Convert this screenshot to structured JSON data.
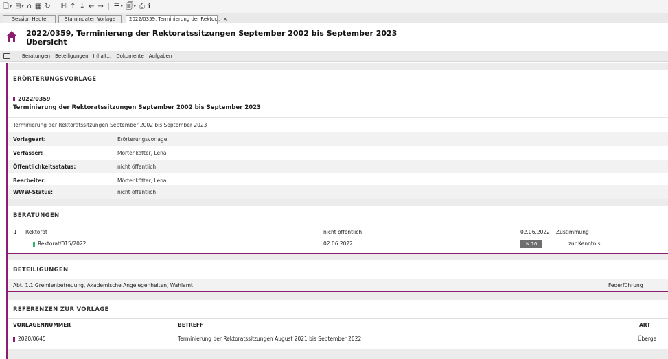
{
  "toolbar": {
    "buttons": [
      {
        "name": "new-document-icon",
        "glyph": "🗋",
        "caret": true
      },
      {
        "name": "window-icon",
        "glyph": "⊟",
        "caret": true
      },
      {
        "name": "home-nav-icon",
        "glyph": "⌂"
      },
      {
        "name": "calendar-icon",
        "glyph": "▦"
      },
      {
        "name": "refresh-icon",
        "glyph": "↻"
      },
      {
        "name": "hierarchy-icon",
        "glyph": "ℍ"
      },
      {
        "name": "arrow-up-icon",
        "glyph": "↑"
      },
      {
        "name": "arrow-down-icon",
        "glyph": "↓"
      },
      {
        "name": "arrow-left-icon",
        "glyph": "←"
      },
      {
        "name": "arrow-right-icon",
        "glyph": "→"
      },
      {
        "name": "list-icon",
        "glyph": "☰",
        "caret": true
      },
      {
        "name": "copy-icon",
        "glyph": "🗐",
        "caret": true
      },
      {
        "name": "print-icon",
        "glyph": "⎙"
      },
      {
        "name": "info-icon",
        "glyph": "i"
      }
    ]
  },
  "tabs": [
    {
      "label": "Session Heute"
    },
    {
      "label": "Stammdaten Vorlage"
    },
    {
      "label": "2022/0359, Terminierung der Rektor...",
      "close": "×"
    }
  ],
  "header": {
    "title": "2022/0359, Terminierung der Rektoratssitzungen September 2002 bis September 2023",
    "subtitle": "Übersicht",
    "accent": "#8b1d70"
  },
  "menu": {
    "items": [
      "Beratungen",
      "Beteiligungen",
      "Inhalt...",
      "Dokumente",
      "Aufgaben"
    ]
  },
  "vorlage": {
    "section_title": "ERÖRTERUNGSVORLAGE",
    "number": "2022/0359",
    "heading": "Terminierung der Rektoratssitzungen September 2002 bis September 2023",
    "description": "Terminierung der Rektoratssitzungen September 2002 bis September 2023",
    "fields": [
      {
        "label": "Vorlageart:",
        "value": "Erörterungsvorlage"
      },
      {
        "label": "Verfasser:",
        "value": "Mörtenkötter, Lena"
      },
      {
        "label": "Öffentlichkeitsstatus:",
        "value": "nicht öffentlich"
      },
      {
        "label": "Bearbeiter:",
        "value": "Mörtenkötter, Lena"
      },
      {
        "label": "WWW-Status:",
        "value": "nicht öffentlich"
      }
    ]
  },
  "beratungen": {
    "section_title": "BERATUNGEN",
    "row1": {
      "index": "1",
      "gremium": "Rektorat",
      "status": "nicht öffentlich",
      "date": "02.06.2022",
      "result": "Zustimmung"
    },
    "row2": {
      "session": "Rektorat/015/2022",
      "date": "02.06.2022",
      "badge": "N 16",
      "result": "zur Kenntnis"
    }
  },
  "beteiligungen": {
    "section_title": "BETEILIGUNGEN",
    "org": "Abt. 1.1 Gremienbetreuung, Akademische Angelegenheiten, Wahlamt",
    "role": "Federführung"
  },
  "referenzen": {
    "section_title": "REFERENZEN ZUR VORLAGE",
    "headers": {
      "nummer": "VORLAGENNUMMER",
      "betreff": "BETREFF",
      "art": "ART"
    },
    "row": {
      "nummer": "2020/0645",
      "betreff": "Terminierung der Rektoratssitzungen August 2021 bis September 2022",
      "art": "Überge"
    }
  }
}
